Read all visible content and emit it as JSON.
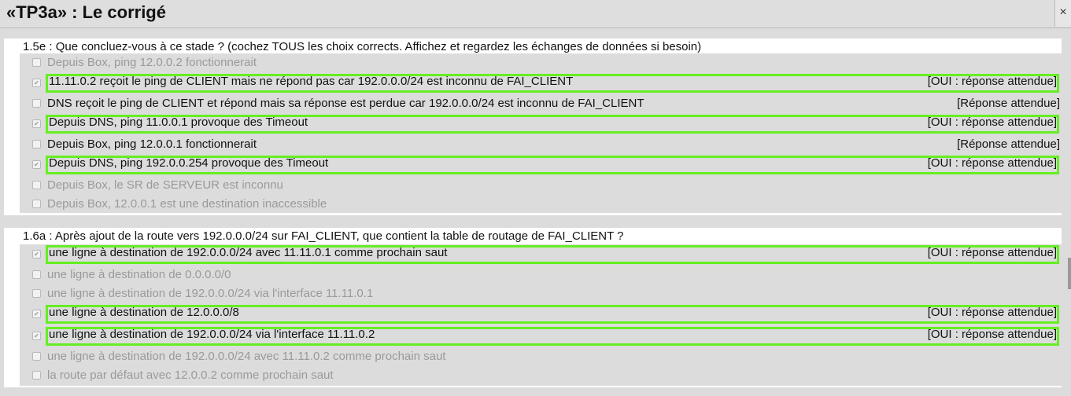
{
  "window": {
    "title": "«TP3a» : Le corrigé",
    "close_symbol": "×"
  },
  "colors": {
    "correct_frame": "#66ee22",
    "background": "#dcdcdc",
    "panel": "#ffffff",
    "disabled_text": "#9a9a9a"
  },
  "q1": {
    "question": "1.5e : Que concluez-vous à ce stade ? (cochez TOUS les choix corrects. Affichez et regardez les échanges de données si besoin)",
    "options": [
      {
        "label": "Depuis Box, ping 12.0.0.2 fonctionnerait",
        "checked": false,
        "state": "disabled",
        "feedback": ""
      },
      {
        "label": "11.11.0.2 reçoit le ping de CLIENT mais ne répond pas car 192.0.0.0/24 est inconnu de FAI_CLIENT",
        "checked": true,
        "state": "correct",
        "feedback": "[OUI : réponse attendue]"
      },
      {
        "label": "DNS reçoit le ping de CLIENT et répond mais sa réponse est perdue car 192.0.0.0/24 est inconnu de FAI_CLIENT",
        "checked": false,
        "state": "missed",
        "feedback": "[Réponse attendue]"
      },
      {
        "label": "Depuis DNS, ping 11.0.0.1 provoque des Timeout",
        "checked": true,
        "state": "correct",
        "feedback": "[OUI : réponse attendue]"
      },
      {
        "label": "Depuis Box, ping 12.0.0.1 fonctionnerait",
        "checked": false,
        "state": "missed",
        "feedback": "[Réponse attendue]"
      },
      {
        "label": "Depuis DNS, ping 192.0.0.254 provoque des Timeout",
        "checked": true,
        "state": "correct",
        "feedback": "[OUI : réponse attendue]"
      },
      {
        "label": "Depuis Box, le SR de SERVEUR est inconnu",
        "checked": false,
        "state": "disabled",
        "feedback": ""
      },
      {
        "label": "Depuis Box, 12.0.0.1 est une destination inaccessible",
        "checked": false,
        "state": "disabled",
        "feedback": ""
      }
    ]
  },
  "q2": {
    "question": "1.6a : Après ajout de la route vers 192.0.0.0/24 sur FAI_CLIENT, que contient la table de routage de FAI_CLIENT ?",
    "options": [
      {
        "label": "une ligne à destination de 192.0.0.0/24 avec 11.11.0.1 comme prochain saut",
        "checked": true,
        "state": "correct",
        "feedback": "[OUI : réponse attendue]"
      },
      {
        "label": "une ligne à destination de 0.0.0.0/0",
        "checked": false,
        "state": "disabled",
        "feedback": ""
      },
      {
        "label": "une ligne à destination de 192.0.0.0/24 via l'interface 11.11.0.1",
        "checked": false,
        "state": "disabled",
        "feedback": ""
      },
      {
        "label": "une ligne à destination de 12.0.0.0/8",
        "checked": true,
        "state": "correct",
        "feedback": "[OUI : réponse attendue]"
      },
      {
        "label": "une ligne à destination de 192.0.0.0/24 via l'interface 11.11.0.2",
        "checked": true,
        "state": "correct",
        "feedback": "[OUI : réponse attendue]"
      },
      {
        "label": "une ligne à destination de 192.0.0.0/24 avec 11.11.0.2 comme prochain saut",
        "checked": false,
        "state": "disabled",
        "feedback": ""
      },
      {
        "label": "la route par défaut avec 12.0.0.2 comme prochain saut",
        "checked": false,
        "state": "disabled",
        "feedback": ""
      }
    ]
  }
}
